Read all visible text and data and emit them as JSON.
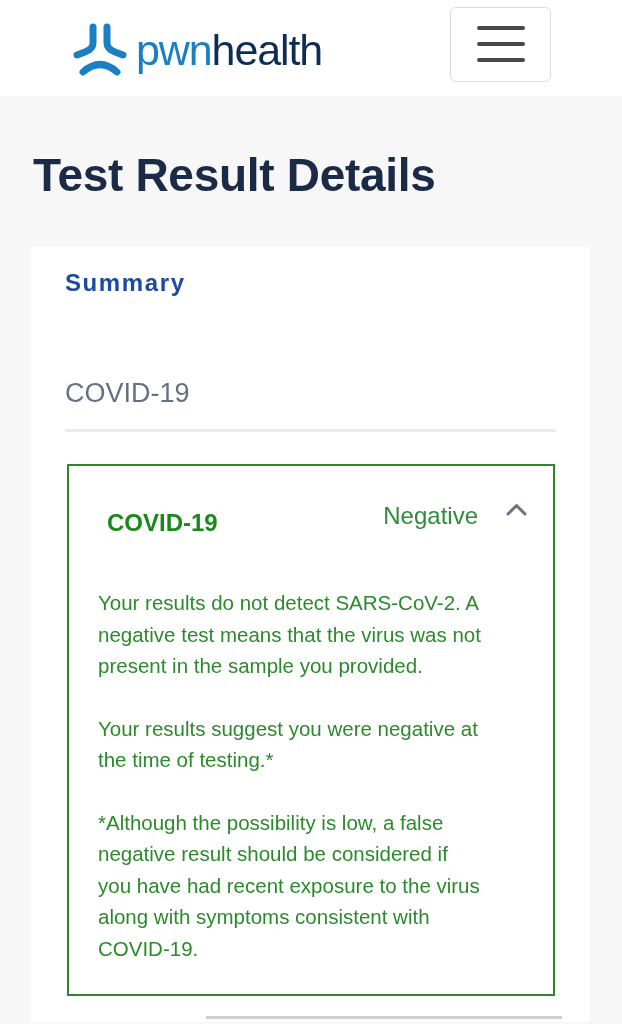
{
  "header": {
    "logo": {
      "parts": [
        {
          "text": "pwn",
          "color": "#1b80c3"
        },
        {
          "text": "health",
          "color": "#0d2d55"
        }
      ]
    }
  },
  "page_title": "Test Result Details",
  "card": {
    "section_label": "Summary",
    "test_group": "COVID-19",
    "results": [
      {
        "test": "COVID-19",
        "result": "Negative",
        "expanded": true,
        "paragraphs": [
          {
            "lines": [
              "Your results do not detect SARS-CoV-2. A",
              "negative test means that the virus was not",
              "present in the sample you provided."
            ]
          },
          {
            "lines": [
              "Your results suggest you were negative at",
              "the time of testing.*"
            ]
          },
          {
            "lines": [
              "*Although the possibility is low, a false",
              "negative result should be considered if",
              "you have had recent exposure to the virus",
              "along with symptoms consistent with",
              "COVID-19."
            ]
          }
        ]
      }
    ]
  }
}
